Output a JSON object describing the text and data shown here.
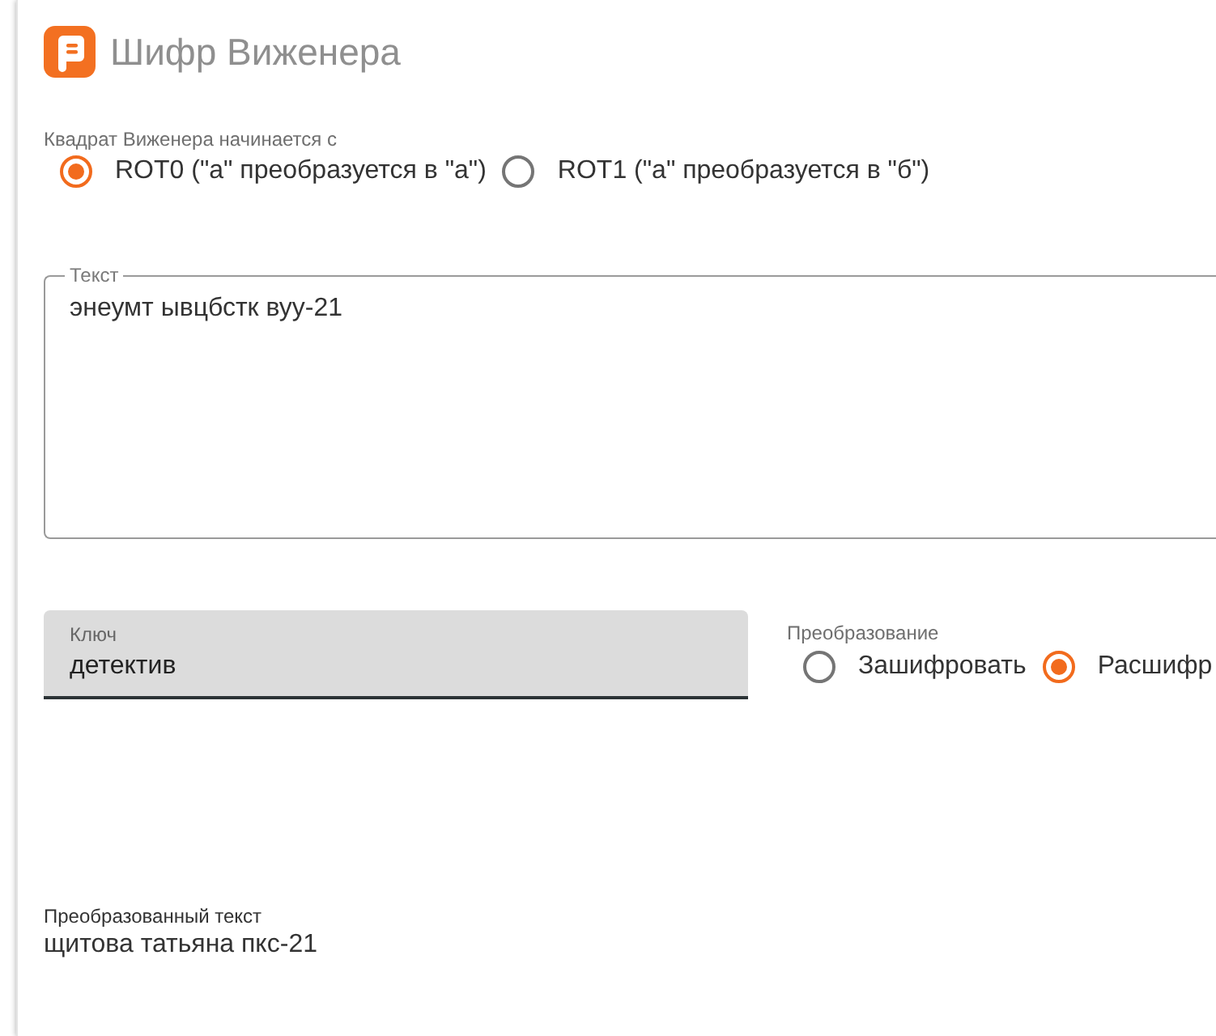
{
  "header": {
    "title": "Шифр Виженера"
  },
  "square_start": {
    "label": "Квадрат Виженера начинается с",
    "options": [
      {
        "label": "ROT0 (\"а\" преобразуется в \"а\")",
        "selected": true
      },
      {
        "label": "ROT1 (\"а\" преобразуется в \"б\")",
        "selected": false
      }
    ]
  },
  "text_field": {
    "label": "Текст",
    "value": "энеумт ывцбстк вуу-21"
  },
  "key_field": {
    "label": "Ключ",
    "value": "детектив"
  },
  "transformation": {
    "label": "Преобразование",
    "options": [
      {
        "label": "Зашифровать",
        "selected": false
      },
      {
        "label": "Расшифр",
        "selected": true
      }
    ]
  },
  "result": {
    "label": "Преобразованный текст",
    "value": "щитова татьяна пкс-21"
  }
}
